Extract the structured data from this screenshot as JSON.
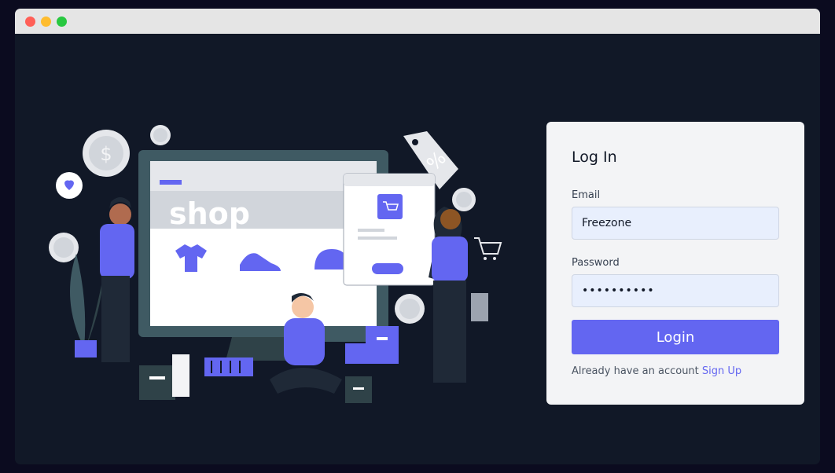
{
  "window": {
    "controls": [
      "close",
      "minimize",
      "maximize"
    ]
  },
  "illustration": {
    "shop_text": "shop",
    "percent_text": "%",
    "dollar_text": "$",
    "heart_icon": "heart-icon",
    "cart_icon": "cart-icon",
    "accent": "#6366f1"
  },
  "login": {
    "title": "Log In",
    "email_label": "Email",
    "email_value": "Freezone",
    "password_label": "Password",
    "password_value": "••••••••••",
    "button_label": "Login",
    "signup_prompt": "Already have an account",
    "signup_link": "Sign Up"
  },
  "colors": {
    "background": "#111827",
    "accent": "#6366f1",
    "card": "#f3f4f6",
    "input": "#e8effd"
  }
}
